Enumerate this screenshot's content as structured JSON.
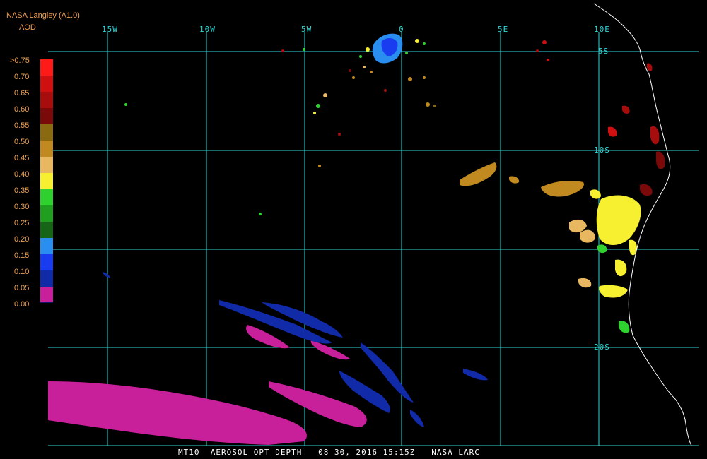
{
  "header": {
    "source": "NASA Langley (A1.0)",
    "variable": "AOD"
  },
  "legend": {
    "title": "AOD",
    "entries": [
      {
        "label": ">0.75",
        "color": "#ff1a1a"
      },
      {
        "label": "0.70",
        "color": "#d01010"
      },
      {
        "label": "0.65",
        "color": "#a80d0d"
      },
      {
        "label": "0.60",
        "color": "#7a0a0a"
      },
      {
        "label": "0.55",
        "color": "#8a6a10"
      },
      {
        "label": "0.50",
        "color": "#c08a20"
      },
      {
        "label": "0.45",
        "color": "#e8b860"
      },
      {
        "label": "0.40",
        "color": "#f6f030"
      },
      {
        "label": "0.35",
        "color": "#2ed12e"
      },
      {
        "label": "0.30",
        "color": "#1f9e1f"
      },
      {
        "label": "0.25",
        "color": "#166416"
      },
      {
        "label": "0.20",
        "color": "#2a8ef0"
      },
      {
        "label": "0.15",
        "color": "#1a3cf0"
      },
      {
        "label": "0.10",
        "color": "#102aa8"
      },
      {
        "label": "0.05",
        "color": "#0a1a6a"
      },
      {
        "label": "0.00",
        "color": "#c81f9a"
      }
    ]
  },
  "grid": {
    "color": "#2fd6d6",
    "longitudes": [
      "15W",
      "10W",
      "5W",
      "0",
      "5E",
      "10E"
    ],
    "latitudes": [
      "5S",
      "10S",
      "20S"
    ]
  },
  "footer": {
    "text": "MT10  AEROSOL OPT DEPTH   08 30, 2016 15:15Z   NASA LARC"
  },
  "coastline_color": "#ffffff"
}
